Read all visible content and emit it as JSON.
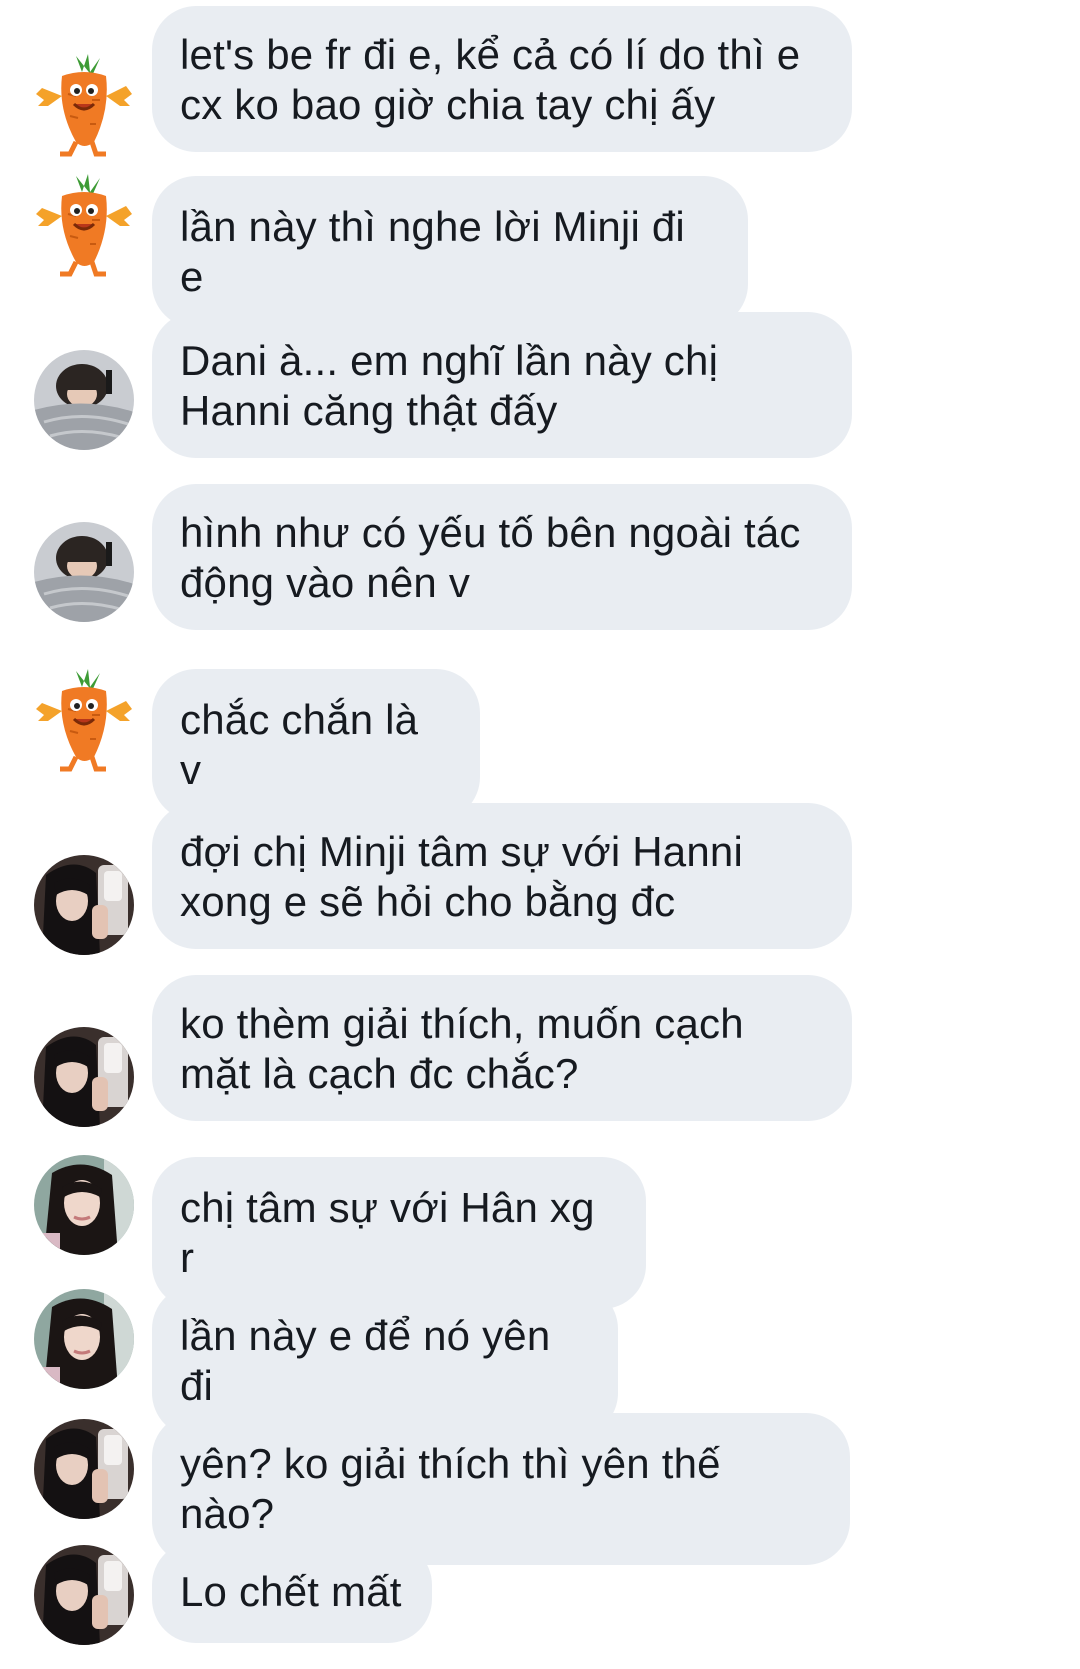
{
  "messages": [
    {
      "sender": "carrot",
      "text": "let's be fr đi e, kể cả có lí do thì e cx ko bao giờ chia tay chị ấy"
    },
    {
      "sender": "carrot",
      "text": "lần này thì nghe lời Minji đi e"
    },
    {
      "sender": "user-bed",
      "text": "Dani à... em nghĩ lần này chị Hanni căng thật đấy"
    },
    {
      "sender": "user-bed",
      "text": "hình như có yếu tố bên ngoài tác động vào nên v"
    },
    {
      "sender": "carrot",
      "text": "chắc chắn là v"
    },
    {
      "sender": "user-selfie",
      "text": "đợi chị Minji tâm sự với Hanni xong e sẽ hỏi cho bằng đc"
    },
    {
      "sender": "user-selfie",
      "text": "ko thèm giải thích, muốn cạch mặt là cạch đc chắc?"
    },
    {
      "sender": "user-portrait",
      "text": "chị tâm sự với Hân xg r"
    },
    {
      "sender": "user-portrait",
      "text": "lần này e để nó yên đi"
    },
    {
      "sender": "user-selfie",
      "text": "yên? ko giải thích thì yên thế nào?"
    },
    {
      "sender": "user-selfie",
      "text": "Lo chết mất"
    }
  ],
  "colors": {
    "bubble_bg": "#e9edf2",
    "text": "#161a20",
    "background": "#ffffff"
  }
}
